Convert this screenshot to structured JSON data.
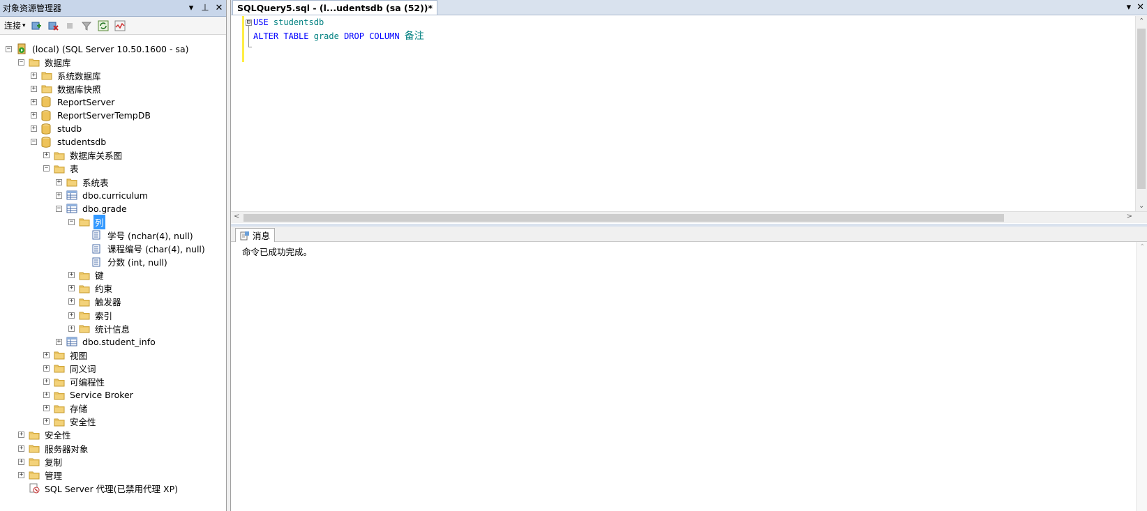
{
  "object_explorer": {
    "title": "对象资源管理器",
    "controls": {
      "dropdown": "▾",
      "pin": "⊥",
      "close": "✕"
    },
    "toolbar": {
      "connect_label": "连接",
      "connect_arrow": "▾"
    },
    "tree": [
      {
        "label": "(local) (SQL Server 10.50.1600 - sa)",
        "level": 0,
        "expander": "⊟",
        "icon": "server-icon"
      },
      {
        "label": "数据库",
        "level": 1,
        "expander": "⊟",
        "icon": "folder-icon"
      },
      {
        "label": "系统数据库",
        "level": 2,
        "expander": "⊞",
        "icon": "folder-icon"
      },
      {
        "label": "数据库快照",
        "level": 2,
        "expander": "⊞",
        "icon": "folder-icon"
      },
      {
        "label": "ReportServer",
        "level": 2,
        "expander": "⊞",
        "icon": "database-icon"
      },
      {
        "label": "ReportServerTempDB",
        "level": 2,
        "expander": "⊞",
        "icon": "database-icon"
      },
      {
        "label": "studb",
        "level": 2,
        "expander": "⊞",
        "icon": "database-icon"
      },
      {
        "label": "studentsdb",
        "level": 2,
        "expander": "⊟",
        "icon": "database-icon"
      },
      {
        "label": "数据库关系图",
        "level": 3,
        "expander": "⊞",
        "icon": "folder-icon"
      },
      {
        "label": "表",
        "level": 3,
        "expander": "⊟",
        "icon": "folder-icon"
      },
      {
        "label": "系统表",
        "level": 4,
        "expander": "⊞",
        "icon": "folder-icon"
      },
      {
        "label": "dbo.curriculum",
        "level": 4,
        "expander": "⊞",
        "icon": "table-icon"
      },
      {
        "label": "dbo.grade",
        "level": 4,
        "expander": "⊟",
        "icon": "table-icon"
      },
      {
        "label": "列",
        "level": 5,
        "expander": "⊟",
        "icon": "folder-icon",
        "selected": true
      },
      {
        "label": "学号 (nchar(4), null)",
        "level": 6,
        "expander": "",
        "icon": "column-icon"
      },
      {
        "label": "课程编号 (char(4), null)",
        "level": 6,
        "expander": "",
        "icon": "column-icon"
      },
      {
        "label": "分数 (int, null)",
        "level": 6,
        "expander": "",
        "icon": "column-icon"
      },
      {
        "label": "键",
        "level": 5,
        "expander": "⊞",
        "icon": "folder-icon"
      },
      {
        "label": "约束",
        "level": 5,
        "expander": "⊞",
        "icon": "folder-icon"
      },
      {
        "label": "触发器",
        "level": 5,
        "expander": "⊞",
        "icon": "folder-icon"
      },
      {
        "label": "索引",
        "level": 5,
        "expander": "⊞",
        "icon": "folder-icon"
      },
      {
        "label": "统计信息",
        "level": 5,
        "expander": "⊞",
        "icon": "folder-icon"
      },
      {
        "label": "dbo.student_info",
        "level": 4,
        "expander": "⊞",
        "icon": "table-icon"
      },
      {
        "label": "视图",
        "level": 3,
        "expander": "⊞",
        "icon": "folder-icon"
      },
      {
        "label": "同义词",
        "level": 3,
        "expander": "⊞",
        "icon": "folder-icon"
      },
      {
        "label": "可编程性",
        "level": 3,
        "expander": "⊞",
        "icon": "folder-icon"
      },
      {
        "label": "Service Broker",
        "level": 3,
        "expander": "⊞",
        "icon": "folder-icon"
      },
      {
        "label": "存储",
        "level": 3,
        "expander": "⊞",
        "icon": "folder-icon"
      },
      {
        "label": "安全性",
        "level": 3,
        "expander": "⊞",
        "icon": "folder-icon"
      },
      {
        "label": "安全性",
        "level": 1,
        "expander": "⊞",
        "icon": "folder-icon"
      },
      {
        "label": "服务器对象",
        "level": 1,
        "expander": "⊞",
        "icon": "folder-icon"
      },
      {
        "label": "复制",
        "level": 1,
        "expander": "⊞",
        "icon": "folder-icon"
      },
      {
        "label": "管理",
        "level": 1,
        "expander": "⊞",
        "icon": "folder-icon"
      },
      {
        "label": "SQL Server 代理(已禁用代理 XP)",
        "level": 1,
        "expander": "",
        "icon": "agent-icon"
      }
    ]
  },
  "editor": {
    "tab_title": "SQLQuery5.sql - (l...udentsdb (sa (52))*",
    "tab_controls": {
      "dropdown": "▾",
      "close": "✕"
    },
    "code": {
      "line1": {
        "kw": "USE",
        "id": "studentsdb"
      },
      "line2": {
        "kw1": "ALTER TABLE",
        "id1": "grade",
        "kw2": "DROP COLUMN",
        "id2": "备注"
      }
    },
    "fold_glyph": "⊟"
  },
  "messages": {
    "tab_label": "消息",
    "text": "命令已成功完成。"
  },
  "colors": {
    "keyword": "#0000ff",
    "identifier": "#008080",
    "selection": "#3399ff",
    "changed_bar": "#ffee44",
    "title_bar": "#c8d6ea"
  }
}
